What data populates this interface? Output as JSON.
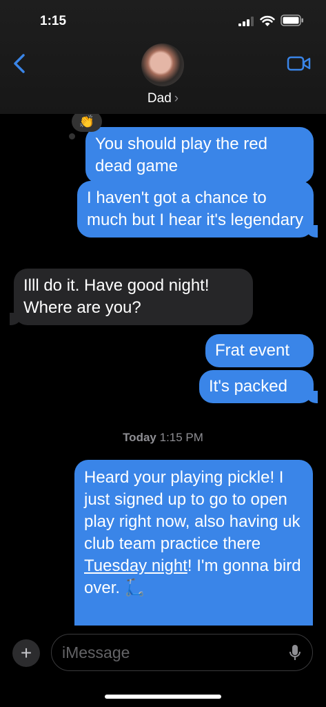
{
  "status": {
    "time": "1:15"
  },
  "header": {
    "contact_name": "Dad",
    "chevron": "›"
  },
  "messages": [
    {
      "text": "You should play the red dead game",
      "reaction": "👏"
    },
    {
      "text": "I haven't got a chance to much but I hear it's legendary"
    },
    {
      "text": "Illl do it. Have good night! Where are you?"
    },
    {
      "text": "Frat event"
    },
    {
      "text": "It's packed"
    },
    {
      "text_before": "Heard your playing pickle! I just signed up to go to open play right now, also having uk club team practice there ",
      "link": "Tuesday night",
      "text_after": "! I'm gonna bird over. 🛴"
    }
  ],
  "timestamp": {
    "day": "Today",
    "time": "1:15 PM"
  },
  "input": {
    "placeholder": "iMessage",
    "add_label": "+"
  },
  "colors": {
    "outgoing": "#3a85e8",
    "incoming": "#262628",
    "accent": "#3a85e8"
  },
  "icons": [
    "back-chevron-icon",
    "video-camera-icon",
    "plus-icon",
    "microphone-icon",
    "signal-icon",
    "wifi-icon",
    "battery-icon"
  ]
}
